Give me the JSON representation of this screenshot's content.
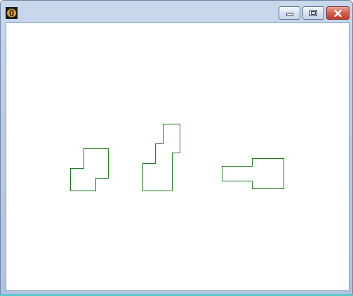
{
  "window": {
    "title": "",
    "icon": "application-icon",
    "controls": [
      "minimize-icon",
      "maximize-icon",
      "close-icon"
    ]
  },
  "canvas": {
    "background": "#ffffff",
    "shape_stroke_color": "#1a7a1a",
    "shapes": [
      "polygon-shape-1",
      "polygon-shape-2",
      "polygon-shape-3"
    ]
  }
}
